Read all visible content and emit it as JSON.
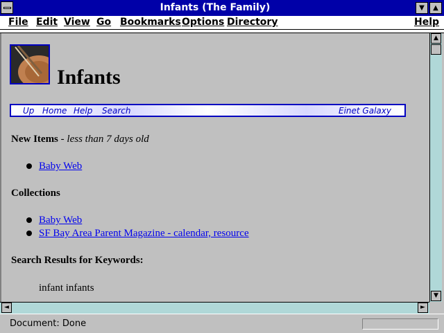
{
  "window": {
    "title": "Infants (The Family)",
    "minimize_glyph": "▼",
    "maximize_glyph": "▲"
  },
  "menu": {
    "items": [
      {
        "label": "File"
      },
      {
        "label": "Edit"
      },
      {
        "label": "View"
      },
      {
        "label": "Go"
      },
      {
        "label": "Bookmarks"
      },
      {
        "label": "Options"
      },
      {
        "label": "Directory"
      },
      {
        "label": "Help"
      }
    ]
  },
  "page": {
    "title": "Infants",
    "nav": {
      "links": [
        "Up",
        "Home",
        "Help",
        "Search"
      ],
      "brand": "Einet Galaxy"
    },
    "new_items": {
      "heading": "New Items",
      "subheading": " - less than 7 days old",
      "links": [
        "Baby Web"
      ]
    },
    "collections": {
      "heading": "Collections",
      "links": [
        "Baby Web",
        "SF Bay Area Parent Magazine - calendar, resource"
      ]
    },
    "search_results": {
      "heading": "Search Results for Keywords:",
      "keywords": "infant infants"
    }
  },
  "status": {
    "text": "Document: Done"
  },
  "scrollbar": {
    "up": "▲",
    "down": "▼",
    "left": "◄",
    "right": "►"
  }
}
